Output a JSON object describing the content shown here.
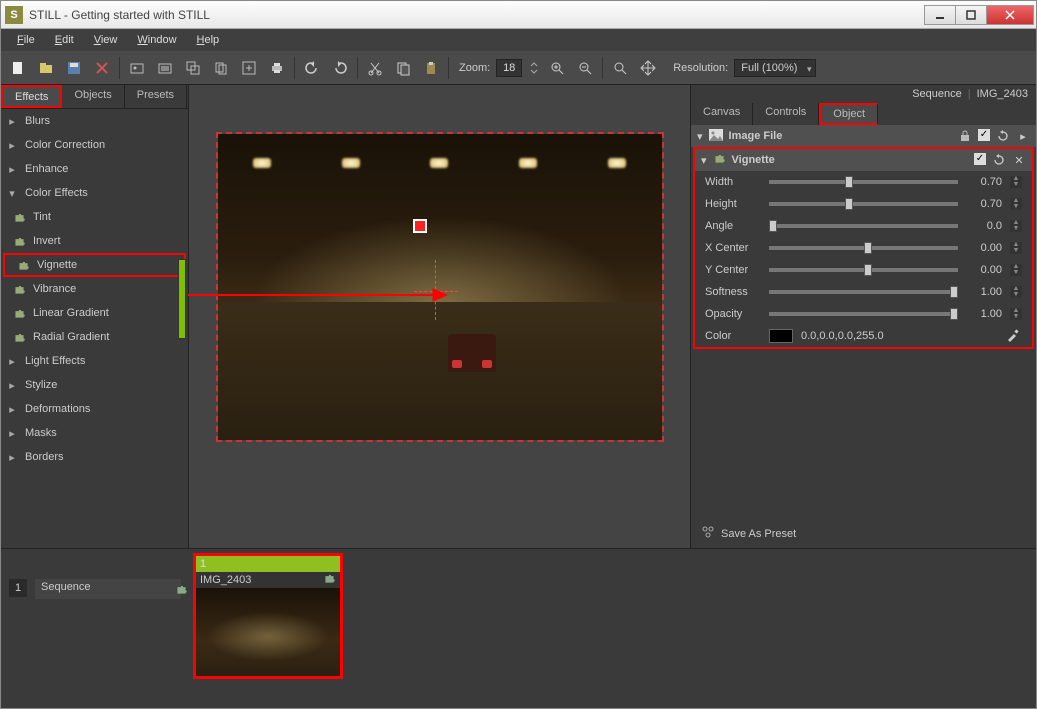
{
  "window": {
    "title": "STILL - Getting started with STILL",
    "app_badge": "S"
  },
  "menu": {
    "file": "File",
    "edit": "Edit",
    "view": "View",
    "window": "Window",
    "help": "Help"
  },
  "toolbar": {
    "zoom_label": "Zoom:",
    "zoom_value": "18",
    "resolution_label": "Resolution:",
    "resolution_value": "Full (100%)"
  },
  "left": {
    "tabs": {
      "effects": "Effects",
      "objects": "Objects",
      "presets": "Presets"
    },
    "groups": {
      "blurs": "Blurs",
      "color_correction": "Color Correction",
      "enhance": "Enhance",
      "color_effects": "Color Effects",
      "light_effects": "Light Effects",
      "stylize": "Stylize",
      "deformations": "Deformations",
      "masks": "Masks",
      "borders": "Borders"
    },
    "color_effects_items": {
      "tint": "Tint",
      "invert": "Invert",
      "vignette": "Vignette",
      "vibrance": "Vibrance",
      "linear_gradient": "Linear Gradient",
      "radial_gradient": "Radial Gradient"
    }
  },
  "right": {
    "context": {
      "sequence": "Sequence",
      "img": "IMG_2403"
    },
    "tabs": {
      "canvas": "Canvas",
      "controls": "Controls",
      "object": "Object"
    },
    "image_file_hdr": "Image File",
    "vignette_hdr": "Vignette",
    "props": {
      "width": {
        "label": "Width",
        "value": "0.70",
        "pos": 0.4
      },
      "height": {
        "label": "Height",
        "value": "0.70",
        "pos": 0.4
      },
      "angle": {
        "label": "Angle",
        "value": "0.0",
        "pos": 0.0
      },
      "xcenter": {
        "label": "X Center",
        "value": "0.00",
        "pos": 0.5
      },
      "ycenter": {
        "label": "Y Center",
        "value": "0.00",
        "pos": 0.5
      },
      "softness": {
        "label": "Softness",
        "value": "1.00",
        "pos": 1.0
      },
      "opacity": {
        "label": "Opacity",
        "value": "1.00",
        "pos": 1.0
      }
    },
    "color": {
      "label": "Color",
      "value": "0.0,0.0,0.0,255.0"
    },
    "save_as_preset": "Save As Preset"
  },
  "bottom": {
    "track_num": "1",
    "sequence_label": "Sequence",
    "clip_num": "1",
    "clip_name": "IMG_2403"
  }
}
